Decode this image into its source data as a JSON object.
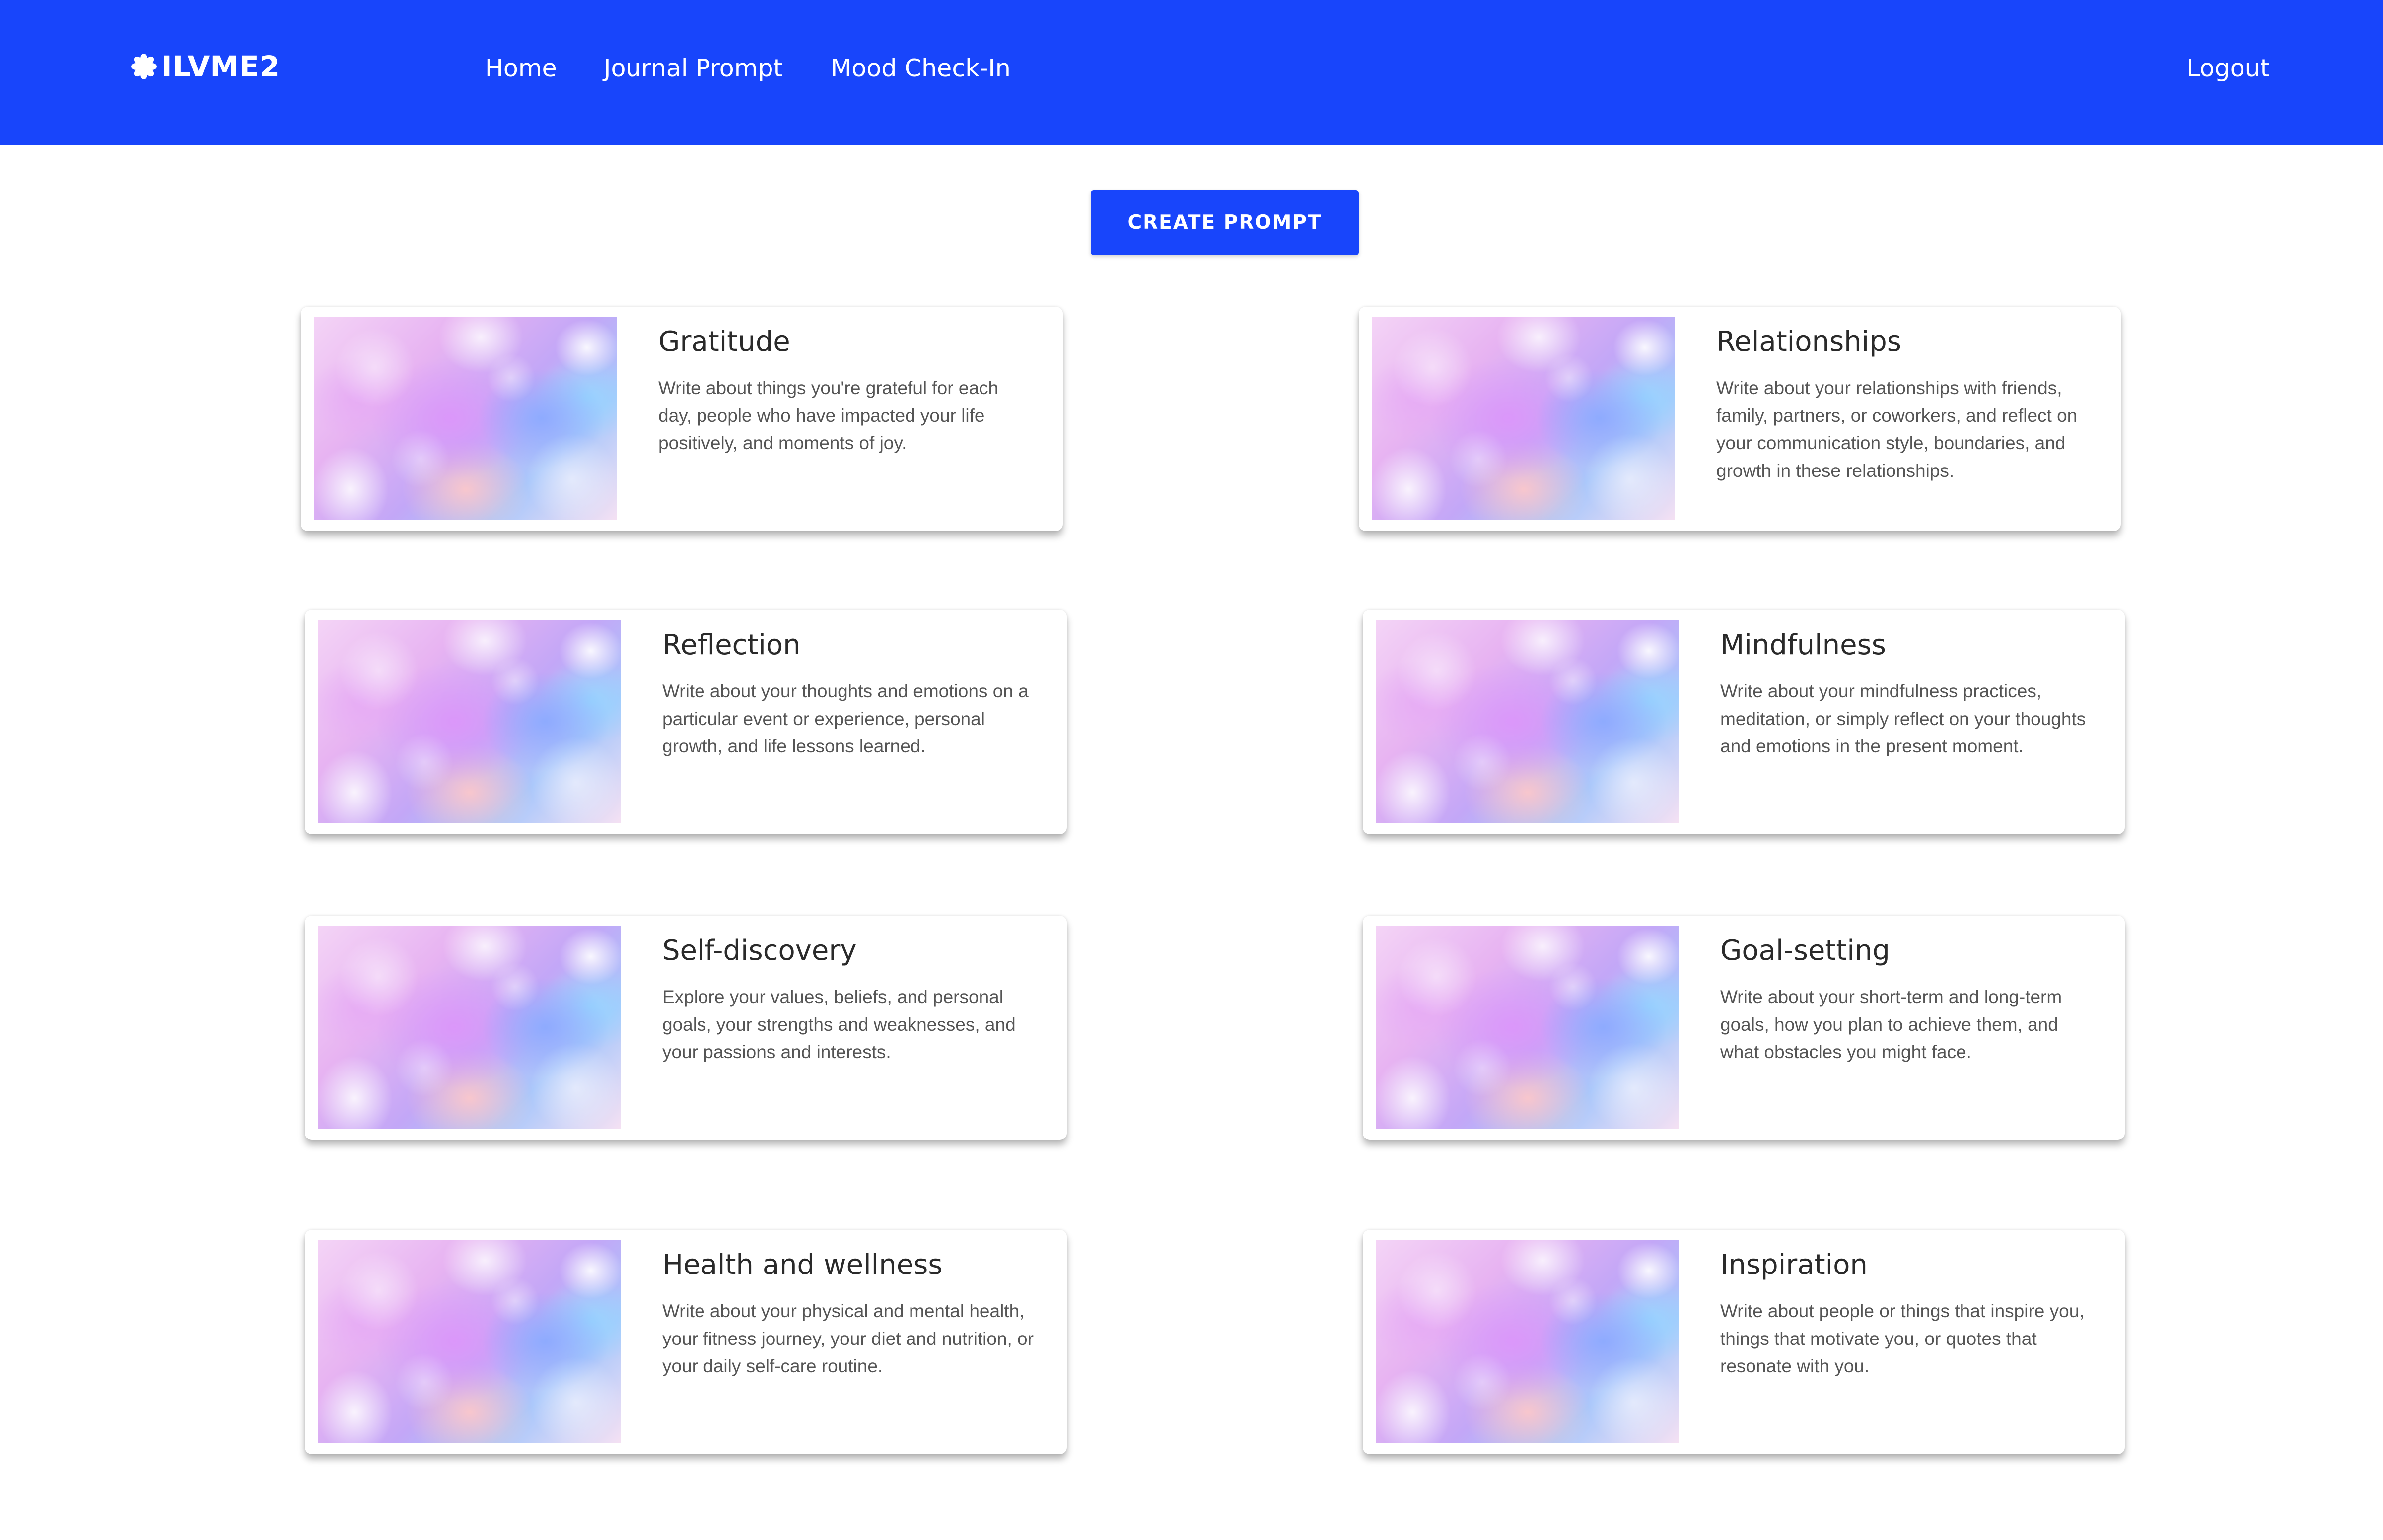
{
  "nav": {
    "brand": "ILVME2",
    "brand_icon": "asterisk-flower-icon",
    "links": [
      "Home",
      "Journal Prompt",
      "Mood Check-In"
    ],
    "logout": "Logout",
    "bg_color": "#1845fb"
  },
  "main": {
    "create_button": "CREATE PROMPT",
    "cards": [
      {
        "title": "Gratitude",
        "description": "Write about things you're grateful for each day, people who have impacted your life positively, and moments of joy."
      },
      {
        "title": "Relationships",
        "description": "Write about your relationships with friends, family, partners, or coworkers, and reflect on your communication style, boundaries, and growth in these relationships."
      },
      {
        "title": "Reflection",
        "description": "Write about your thoughts and emotions on a particular event or experience, personal growth, and life lessons learned."
      },
      {
        "title": "Mindfulness",
        "description": "Write about your mindfulness practices, meditation, or simply reflect on your thoughts and emotions in the present moment."
      },
      {
        "title": "Self-discovery",
        "description": "Explore your values, beliefs, and personal goals, your strengths and weaknesses, and your passions and interests."
      },
      {
        "title": "Goal-setting",
        "description": "Write about your short-term and long-term goals, how you plan to achieve them, and what obstacles you might face."
      },
      {
        "title": "Health and wellness",
        "description": "Write about your physical and mental health, your fitness journey, your diet and nutrition, or your daily self-care routine."
      },
      {
        "title": "Inspiration",
        "description": "Write about people or things that inspire you, things that motivate you, or quotes that resonate with you."
      }
    ]
  }
}
